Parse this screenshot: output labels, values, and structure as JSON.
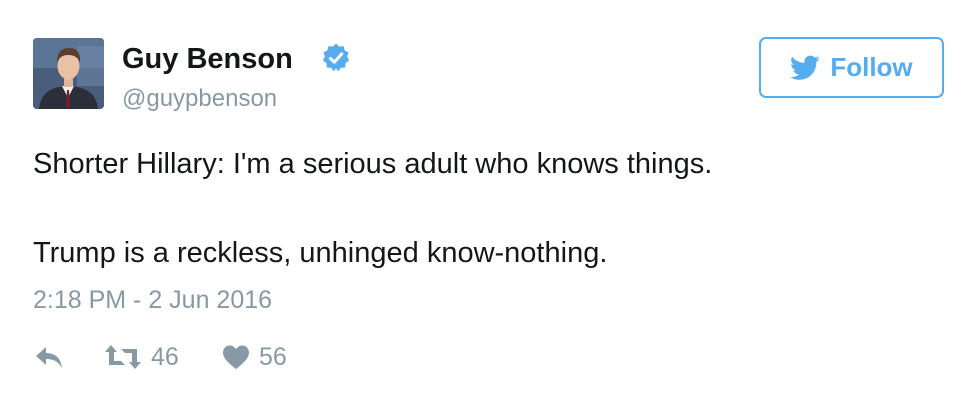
{
  "author": {
    "name": "Guy Benson",
    "handle": "@guypbenson",
    "avatar_icon": "profile-photo",
    "verified_icon": "verified-badge-icon",
    "verified_color": "#55acee"
  },
  "follow_button": {
    "label": "Follow",
    "icon": "twitter-bird-icon",
    "color": "#55acee"
  },
  "tweet": {
    "line1": "Shorter Hillary: I'm a serious adult who knows things.",
    "line2": "Trump is a reckless, unhinged know-nothing.",
    "timestamp": "2:18 PM - 2 Jun 2016"
  },
  "actions": {
    "reply": {
      "icon": "reply-icon"
    },
    "retweet": {
      "icon": "retweet-icon",
      "count": "46"
    },
    "like": {
      "icon": "heart-icon",
      "count": "56"
    }
  },
  "colors": {
    "text": "#14171a",
    "muted": "#8899a6",
    "accent": "#55acee"
  }
}
